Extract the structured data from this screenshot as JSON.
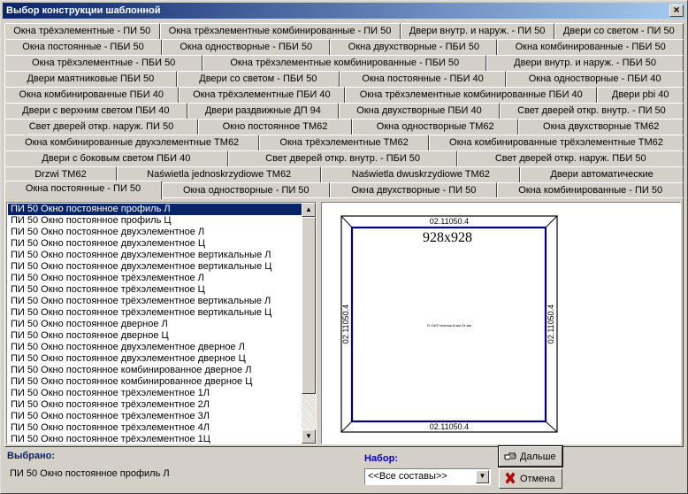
{
  "window": {
    "title": "Выбор конструкции шаблонной",
    "close_glyph": "×"
  },
  "tab_rows": [
    [
      "Окна трёхэлементные - ПИ 50",
      "Окна трёхэлементные комбинированные - ПИ 50",
      "Двери внутр. и наруж. - ПИ 50",
      "Двери со светом - ПИ 50"
    ],
    [
      "Окна постоянные - ПБИ 50",
      "Окна одностворные - ПБИ 50",
      "Окна двухстворные - ПБИ 50",
      "Окна комбинированные - ПБИ 50"
    ],
    [
      "Окна трёхэлементные - ПБИ 50",
      "Окна трёхэлементные комбинированные - ПБИ 50",
      "Двери внутр. и наруж. - ПБИ 50"
    ],
    [
      "Двери маятниковые ПБИ 50",
      "Двери со светом - ПБИ 50",
      "Окна постоянные - ПБИ 40",
      "Окна одностворные - ПБИ 40"
    ],
    [
      "Окна комбинированные ПБИ 40",
      "Окна трёхэлементные ПБИ 40",
      "Окна трёхэлементные комбинированные ПБИ 40",
      "Двери pbi 40"
    ],
    [
      "Двери с верхним светом ПБИ 40",
      "Двери раздвижные ДП 94",
      "Окна двухстворные ПБИ 40",
      "Свет дверей откр. внутр. - ПИ 50"
    ],
    [
      "Свет дверей откр. наруж. ПИ 50",
      "Окно постоянное ТМ62",
      "Окна одностворные ТМ62",
      "Окна двухстворные ТМ62"
    ],
    [
      "Окна комбинированные двухэлементные ТМ62",
      "Окна трёхэлементные ТМ62",
      "Окна комбинированные трёхэлементные ТМ62"
    ],
    [
      "Двери с боковым светом ПБИ 40",
      "Свет дверей откр. внутр. - ПБИ 50",
      "Свет дверей откр. наруж. ПБИ 50"
    ],
    [
      "Drzwi TM62",
      "Naświetla jednoskrzydiowe TM62",
      "Naświetla dwuskrzydiowe TM62",
      "Двери автоматические"
    ],
    [
      "Окна постоянные - ПИ 50",
      "Окна одностворные - ПИ 50",
      "Окна двухстворные - ПИ 50",
      "Окна комбинированные - ПИ 50"
    ]
  ],
  "active_tab": "Окна постоянные - ПИ 50",
  "list": {
    "selected_index": 0,
    "items": [
      "ПИ 50 Окно постоянное профиль Л",
      "ПИ 50 Окно постоянное профиль Ц",
      "ПИ 50 Окно постоянное двухэлементное Л",
      "ПИ 50 Окно постоянное двухэлементное Ц",
      "ПИ 50 Окно постоянное двухэлементное вертикальные Л",
      "ПИ 50 Окно постоянное двухэлементное вертикальные Ц",
      "ПИ 50 Окно постоянное трёхэлементное Л",
      "ПИ 50 Окно постоянное трёхэлементное Ц",
      "ПИ 50 Окно постоянное трёхэлементное вертикальные Л",
      "ПИ 50 Окно постоянное трёхэлементное вертикальные Ц",
      "ПИ 50 Окно постоянное дверное Л",
      "ПИ 50 Окно постоянное дверное Ц",
      "ПИ 50 Окно постоянное двухэлементное дверное Л",
      "ПИ 50 Окно постоянное двухэлементное дверное Ц",
      "ПИ 50 Окно постоянное комбинированное дверное Л",
      "ПИ 50 Окно постоянное комбинированное дверное Ц",
      "ПИ 50 Окно постоянное трёхэлементное 1Л",
      "ПИ 50 Окно постоянное трёхэлементное 2Л",
      "ПИ 50 Окно постоянное трёхэлементное 3Л",
      "ПИ 50 Окно постоянное трёхэлементное 4Л",
      "ПИ 50 Окно постоянное трёхэлементное 1Ц"
    ]
  },
  "scrollbar": {
    "up_glyph": "▲",
    "down_glyph": "▼"
  },
  "preview": {
    "dimension": "928x928",
    "profile_top": "02.11050.4",
    "profile_bottom": "02.11050.4",
    "profile_left": "02.11050.4",
    "profile_right": "02.11050.4",
    "center_caption": "FLOAT+пленка 8 мм  24 мм",
    "frame_color": "#000080"
  },
  "footer": {
    "selected_label": "Выбрано:",
    "selected_value": "ПИ 50 Окно постоянное профиль Л",
    "set_label": "Набор:",
    "set_value": "<<Все составы>>",
    "combo_glyph": "▼",
    "next_label": "Дальше",
    "cancel_label": "Отмена"
  },
  "icons": {
    "next": "hand-pointing-icon",
    "cancel": "red-x-icon"
  },
  "colors": {
    "title_start": "#0a246a",
    "title_end": "#a6caf0",
    "selection": "#0a246a",
    "label_blue": "#0000c0",
    "cancel_red": "#d00000"
  }
}
